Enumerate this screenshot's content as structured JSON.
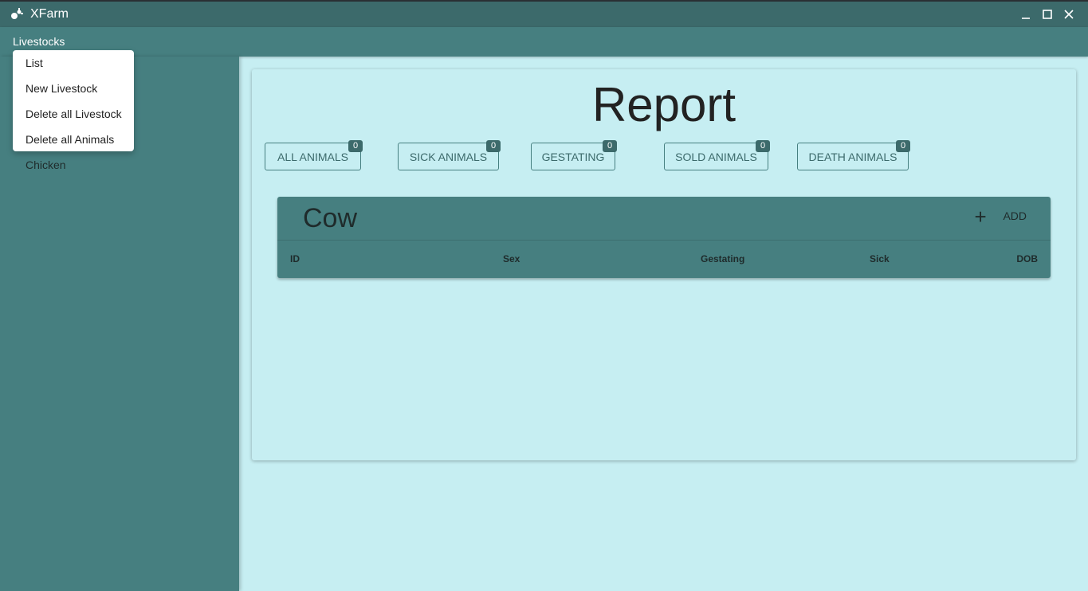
{
  "window": {
    "title": "XFarm",
    "icon": "farm-app-icon"
  },
  "menubar": {
    "menu_label": "Livestocks"
  },
  "dropdown": {
    "items": [
      "List",
      "New Livestock",
      "Delete all Livestock",
      "Delete all Animals"
    ]
  },
  "sidebar": {
    "items": [
      "Chicken"
    ]
  },
  "report": {
    "title": "Report",
    "buttons": [
      {
        "label": "ALL ANIMALS",
        "count": "0"
      },
      {
        "label": "SICK ANIMALS",
        "count": "0"
      },
      {
        "label": "GESTATING",
        "count": "0"
      },
      {
        "label": "SOLD ANIMALS",
        "count": "0"
      },
      {
        "label": "DEATH ANIMALS",
        "count": "0"
      }
    ]
  },
  "table": {
    "title": "Cow",
    "add_label": "ADD",
    "columns": [
      "ID",
      "Sex",
      "Gestating",
      "Sick",
      "DOB"
    ]
  },
  "colors": {
    "titlebar": "#3c6a6b",
    "primary": "#467f80",
    "background": "#c6eef2"
  }
}
